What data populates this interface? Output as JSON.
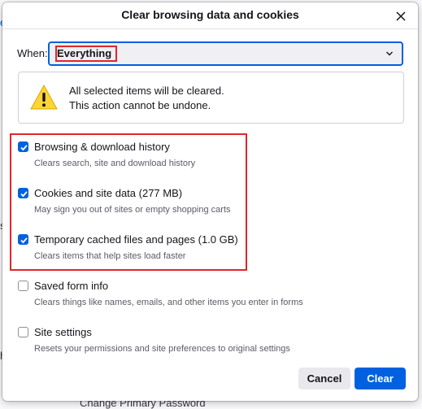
{
  "dialog": {
    "title": "Clear browsing data and cookies"
  },
  "when": {
    "label": "When:",
    "selected": "Everything"
  },
  "warning": {
    "line1": "All selected items will be cleared.",
    "line2": "This action cannot be undone."
  },
  "options": [
    {
      "label": "Browsing & download history",
      "description": "Clears search, site and download history",
      "checked": true
    },
    {
      "label": "Cookies and site data (277 MB)",
      "description": "May sign you out of sites or empty shopping carts",
      "checked": true
    },
    {
      "label": "Temporary cached files and pages (1.0 GB)",
      "description": "Clears items that help sites load faster",
      "checked": true
    },
    {
      "label": "Saved form info",
      "description": "Clears things like names, emails, and other items you enter in forms",
      "checked": false
    },
    {
      "label": "Site settings",
      "description": "Resets your permissions and site preferences to original settings",
      "checked": false
    }
  ],
  "buttons": {
    "cancel": "Cancel",
    "clear": "Clear"
  },
  "background": {
    "bottom_text": "Change Primary Password",
    "left_fragments": [
      "e",
      "s",
      "h"
    ]
  },
  "colors": {
    "accent": "#0061e0",
    "highlight_red": "#e3252a",
    "warning_yellow": "#ffd435"
  }
}
